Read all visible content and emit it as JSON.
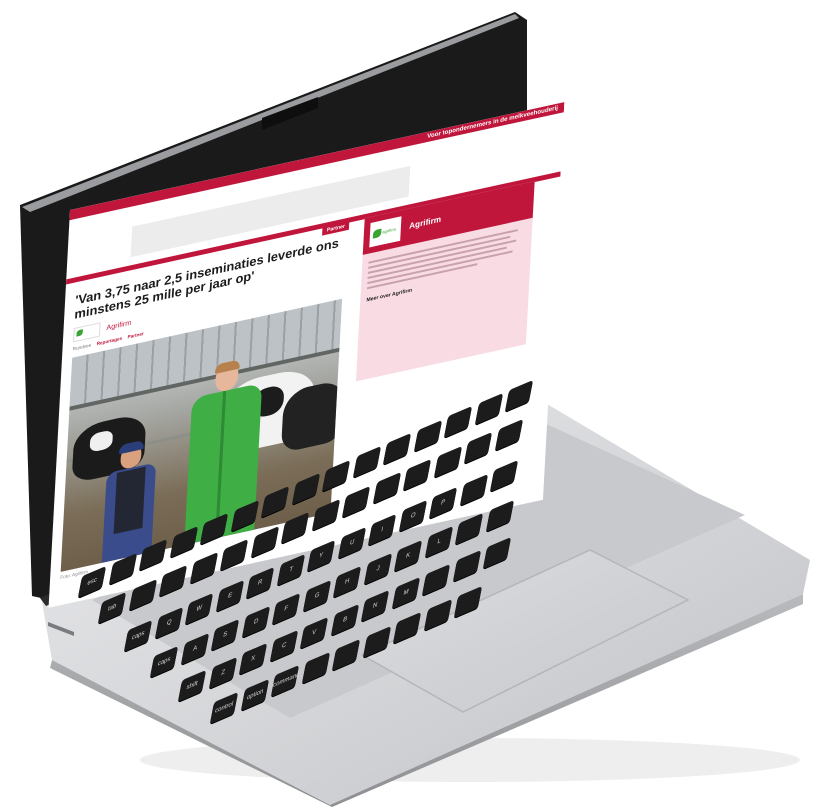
{
  "site": {
    "topbar_text": "Voor topondernemers in de melkveehouderij",
    "partner_tag": "Partner",
    "headline": "'Van 3,75 naar 2,5 inseminaties leverde ons minstens 25 mille per jaar op'",
    "brand_name": "Agrifirm",
    "logo_text": "agrifirm",
    "tags": {
      "tag1": "Rundvee",
      "tag2": "Reportages",
      "tag3": "Partner"
    },
    "photo_caption": "Foto: Agrifirm",
    "sidebar": {
      "title": "Agrifirm",
      "more_link": "Meer over Agrifirm"
    }
  },
  "keyboard": {
    "keys_row1": [
      "esc",
      "",
      "",
      "",
      "",
      "",
      "",
      "",
      "",
      "",
      "",
      "",
      "delete"
    ],
    "label_tab": "tab",
    "label_caps": "caps lock",
    "label_shift": "shift",
    "label_control": "control",
    "label_option": "option",
    "label_command": "command",
    "label_return": "return",
    "letters_row2": [
      "Q",
      "W",
      "E",
      "R",
      "T",
      "Y",
      "U",
      "I",
      "O",
      "P"
    ],
    "letters_row3": [
      "A",
      "S",
      "D",
      "F",
      "G",
      "H",
      "J",
      "K",
      "L"
    ],
    "letters_row4": [
      "Z",
      "X",
      "C",
      "V",
      "B",
      "N",
      "M"
    ]
  },
  "colors": {
    "brand_red": "#c0163c",
    "sidebar_bg": "#f8dbe3",
    "agrifirm_green": "#3aa535",
    "laptop_silver": "#d7d8da",
    "key_black": "#1c1c1d"
  }
}
